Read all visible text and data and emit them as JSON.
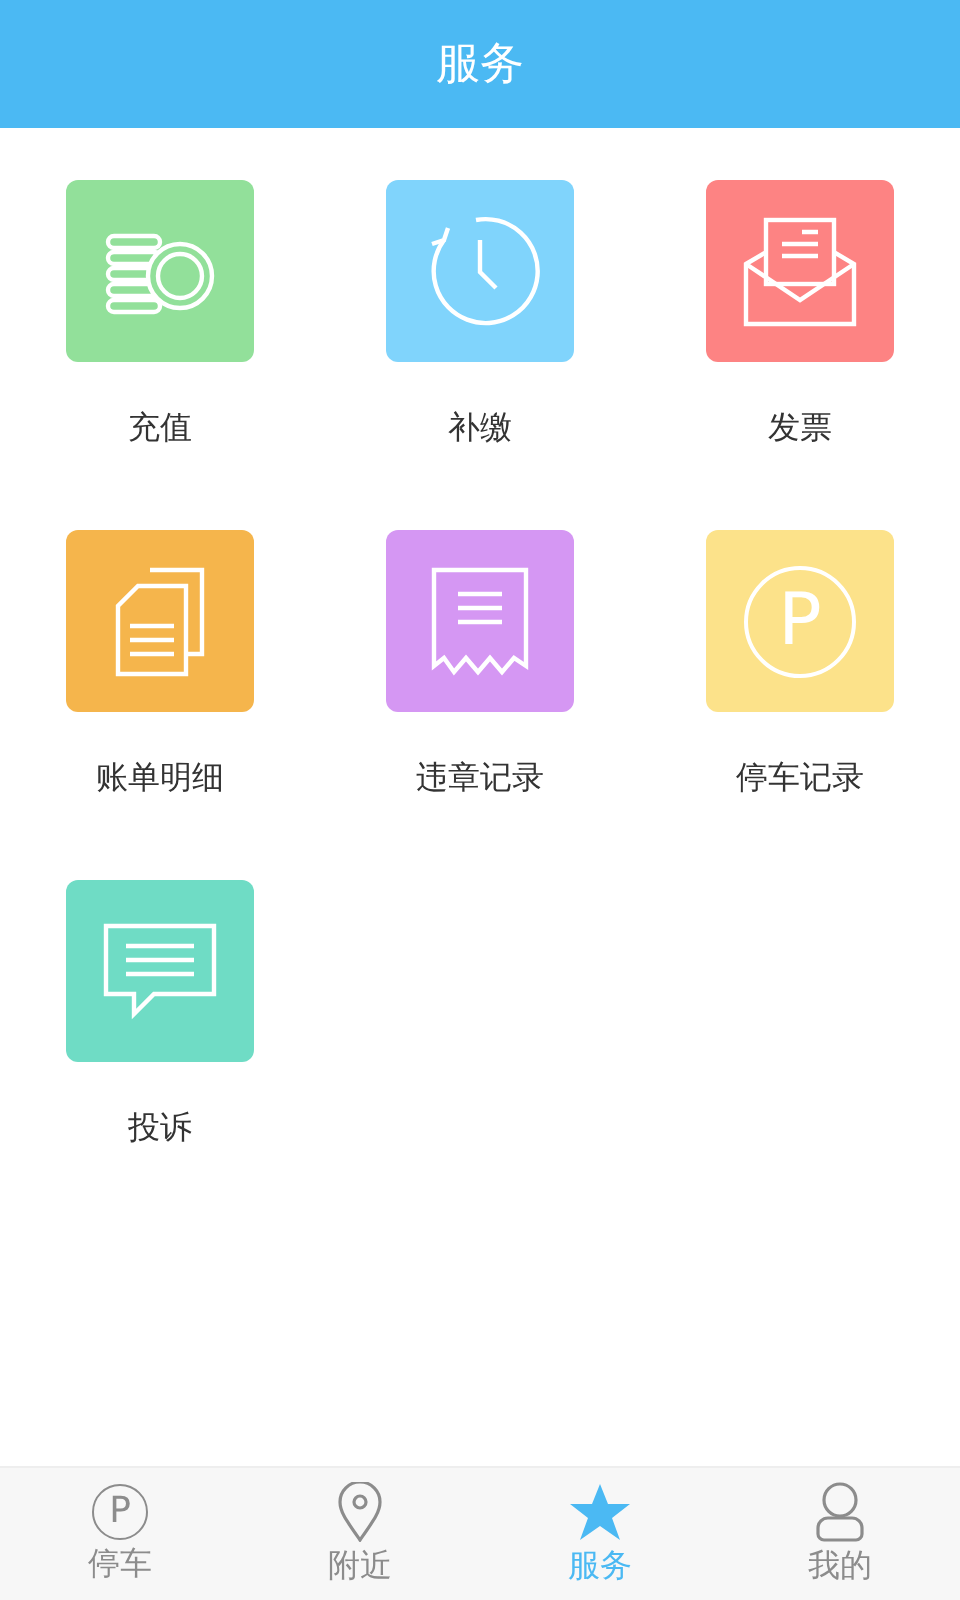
{
  "header": {
    "title": "服务"
  },
  "services": [
    {
      "label": "充值",
      "kind": "coins",
      "color": "#92e09a"
    },
    {
      "label": "补缴",
      "kind": "clock",
      "color": "#80d4fc"
    },
    {
      "label": "发票",
      "kind": "invoice",
      "color": "#fd8383"
    },
    {
      "label": "账单明细",
      "kind": "bill",
      "color": "#f5b54c"
    },
    {
      "label": "违章记录",
      "kind": "receipt",
      "color": "#d597f3"
    },
    {
      "label": "停车记录",
      "kind": "parking",
      "color": "#fce28a",
      "glyph": "P"
    },
    {
      "label": "投诉",
      "kind": "chat",
      "color": "#6fdcc5"
    }
  ],
  "tabs": [
    {
      "label": "停车",
      "kind": "parking",
      "glyph": "P",
      "selected": false
    },
    {
      "label": "附近",
      "kind": "pin",
      "selected": false
    },
    {
      "label": "服务",
      "kind": "star",
      "selected": true
    },
    {
      "label": "我的",
      "kind": "person",
      "selected": false
    }
  ]
}
